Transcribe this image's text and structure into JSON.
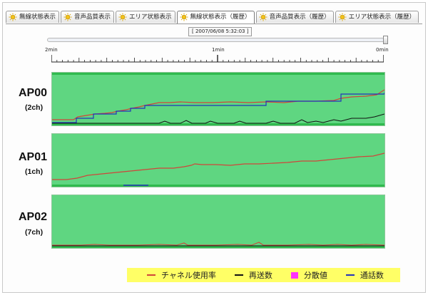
{
  "tabs": [
    {
      "label": "無線状態表示",
      "active": false
    },
    {
      "label": "音声品質表示",
      "active": false
    },
    {
      "label": "エリア状態表示",
      "active": false
    },
    {
      "label": "無線状態表示（履歴）",
      "active": true
    },
    {
      "label": "音声品質表示（履歴）",
      "active": false
    },
    {
      "label": "エリア状態表示（履歴）",
      "active": false
    }
  ],
  "timestamp": "[ 2007/06/08 5:32:03 ]",
  "slider": {
    "position": 1.0
  },
  "time_axis": {
    "left": "2min",
    "mid": "1min",
    "right": "0min"
  },
  "panels": [
    {
      "name": "AP00",
      "channel": "(2ch)"
    },
    {
      "name": "AP01",
      "channel": "(1ch)"
    },
    {
      "name": "AP02",
      "channel": "(7ch)"
    }
  ],
  "legend": [
    {
      "label": "チャネル使用率",
      "color": "#d0453a",
      "kind": "line"
    },
    {
      "label": "再送数",
      "color": "#111111",
      "kind": "line"
    },
    {
      "label": "分散値",
      "color": "#ff33ff",
      "kind": "box"
    },
    {
      "label": "通話数",
      "color": "#2233bb",
      "kind": "line"
    }
  ],
  "colors": {
    "panel_bg": "#5fd681",
    "panel_top": "#2fba4e",
    "legend_bg": "#ffff66"
  }
}
